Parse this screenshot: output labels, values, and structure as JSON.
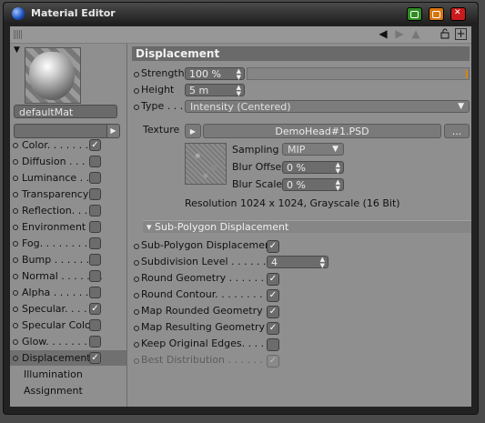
{
  "window": {
    "title": "Material Editor"
  },
  "toolbar": {
    "back_icon": "◀",
    "forward_icon": "▶",
    "up_icon": "▲",
    "lock_icon": "🔓",
    "add_icon": "+"
  },
  "material": {
    "name": "defaultMat"
  },
  "channels": [
    {
      "label": "Color. . . . . . . . ",
      "checked": true
    },
    {
      "label": "Diffusion . . . . .",
      "checked": false
    },
    {
      "label": "Luminance . . . .",
      "checked": false
    },
    {
      "label": "Transparency",
      "checked": false
    },
    {
      "label": "Reflection. . . . .",
      "checked": false
    },
    {
      "label": "Environment",
      "checked": false
    },
    {
      "label": "Fog. . . . . . . . . .",
      "checked": false
    },
    {
      "label": "Bump . . . . . . . .",
      "checked": false
    },
    {
      "label": "Normal . . . . . . .",
      "checked": false
    },
    {
      "label": "Alpha . . . . . . . .",
      "checked": false
    },
    {
      "label": "Specular. . . . . .",
      "checked": true
    },
    {
      "label": "Specular Color",
      "checked": false
    },
    {
      "label": "Glow. . . . . . . . .",
      "checked": false
    },
    {
      "label": "Displacement",
      "checked": true,
      "selected": true
    }
  ],
  "extra_items": [
    "Illumination",
    "Assignment"
  ],
  "displacement": {
    "header": "Displacement",
    "strength_label": "Strength",
    "strength_value": "100 %",
    "height_label": "Height",
    "height_value": "5 m",
    "type_label": "Type . . .",
    "type_value": "Intensity (Centered)",
    "texture_label": "Texture",
    "texture_file": "DemoHead#1.PSD",
    "texture_more": "...",
    "sampling_label": "Sampling",
    "sampling_value": "MIP",
    "blur_offset_label": "Blur Offset",
    "blur_offset_value": "0 %",
    "blur_scale_label": "Blur Scale",
    "blur_scale_value": "0 %",
    "resolution_text": "Resolution 1024 x 1024, Grayscale (16 Bit)"
  },
  "subpoly": {
    "header": "Sub-Polygon Displacement",
    "items": [
      {
        "label": "Sub-Polygon Displacement",
        "checked": true
      },
      {
        "label": "Subdivision Level . . . . . . .",
        "value": "4"
      },
      {
        "label": "Round Geometry . . . . . . . .",
        "checked": true
      },
      {
        "label": "Round Contour. . . . . . . . .",
        "checked": true
      },
      {
        "label": "Map Rounded Geometry .",
        "checked": true
      },
      {
        "label": "Map Resulting Geometry .",
        "checked": true
      },
      {
        "label": "Keep Original Edges. . . . .",
        "checked": false
      },
      {
        "label": "Best Distribution . . . . . . . .",
        "checked": true,
        "disabled": true
      }
    ]
  },
  "colors": {
    "window_bg": "#8f8f8f",
    "title_bar": "#1e1e1e",
    "accent_orange": "#d7850e",
    "close": "#c81b1b",
    "minimize": "#2f8d22",
    "maximize": "#d87510"
  }
}
